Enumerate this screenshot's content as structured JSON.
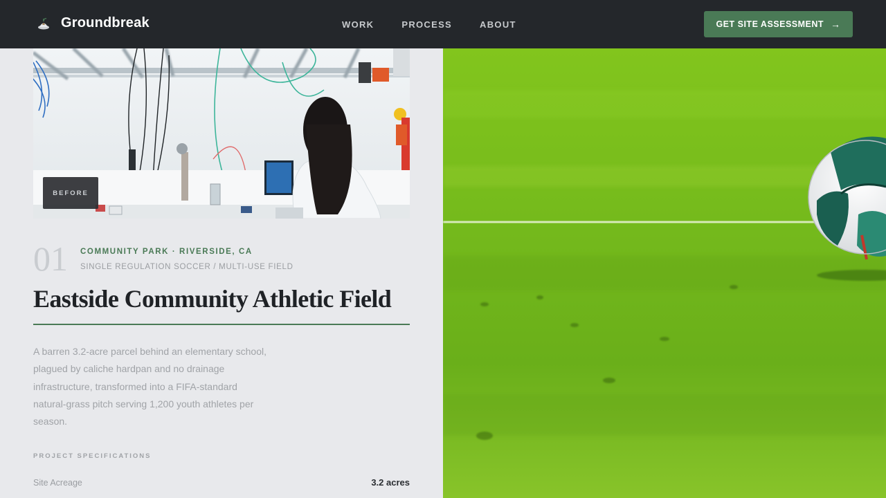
{
  "nav": {
    "brand": "Groundbreak",
    "links": [
      "WORK",
      "PROCESS",
      "ABOUT"
    ],
    "cta_label": "GET SITE ASSESSMENT"
  },
  "project": {
    "before_label": "BEFORE",
    "number": "01",
    "location": "COMMUNITY PARK · RIVERSIDE, CA",
    "type": "SINGLE REGULATION SOCCER / MULTI-USE FIELD",
    "title": "Eastside Community Athletic Field",
    "description": "A barren 3.2-acre parcel behind an elementary school, plagued by caliche hardpan and no drainage infrastructure, transformed into a FIFA-standard natural-grass pitch serving 1,200 youth athletes per season.",
    "specs_heading": "PROJECT SPECIFICATIONS",
    "specs": [
      {
        "label": "Site Acreage",
        "value": "3.2 acres"
      }
    ]
  },
  "colors": {
    "nav_bg": "#24272b",
    "accent": "#4a7a56",
    "panel_bg": "#e8e9ec",
    "grass": "#7cc21f"
  }
}
